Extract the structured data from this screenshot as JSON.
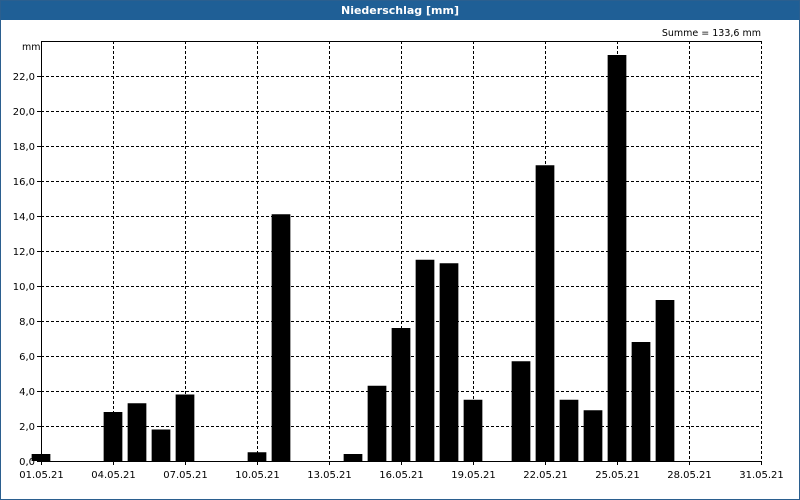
{
  "window": {
    "title": "Niederschlag [mm]"
  },
  "chart_data": {
    "type": "bar",
    "title": "Niederschlag [mm]",
    "ylabel": "mm",
    "annotation": "Summe = 133,6 mm",
    "ylim": [
      0,
      24
    ],
    "yticks": [
      0,
      2,
      4,
      6,
      8,
      10,
      12,
      14,
      16,
      18,
      20,
      22
    ],
    "ytick_labels": [
      "0,0",
      "2,0",
      "4,0",
      "6,0",
      "8,0",
      "10,0",
      "12,0",
      "14,0",
      "16,0",
      "18,0",
      "20,0",
      "22,0"
    ],
    "xlim_days": [
      1,
      31
    ],
    "xtick_days": [
      1,
      4,
      7,
      10,
      13,
      16,
      19,
      22,
      25,
      28,
      31
    ],
    "xtick_labels": [
      "01.05.21",
      "04.05.21",
      "07.05.21",
      "10.05.21",
      "13.05.21",
      "16.05.21",
      "19.05.21",
      "22.05.21",
      "25.05.21",
      "28.05.21",
      "31.05.21"
    ],
    "grid": true,
    "categories": [
      "01.05.21",
      "02.05.21",
      "03.05.21",
      "04.05.21",
      "05.05.21",
      "06.05.21",
      "07.05.21",
      "08.05.21",
      "09.05.21",
      "10.05.21",
      "11.05.21",
      "12.05.21",
      "13.05.21",
      "14.05.21",
      "15.05.21",
      "16.05.21",
      "17.05.21",
      "18.05.21",
      "19.05.21",
      "20.05.21",
      "21.05.21",
      "22.05.21",
      "23.05.21",
      "24.05.21",
      "25.05.21",
      "26.05.21",
      "27.05.21",
      "28.05.21",
      "29.05.21",
      "30.05.21",
      "31.05.21"
    ],
    "values": [
      0.4,
      0,
      0,
      2.8,
      3.3,
      1.8,
      3.8,
      0,
      0,
      0.5,
      14.1,
      0,
      0,
      0.4,
      4.3,
      7.6,
      11.5,
      11.3,
      3.5,
      0,
      5.7,
      16.9,
      3.5,
      2.9,
      23.2,
      6.8,
      9.2,
      0,
      0,
      0,
      0
    ],
    "bar_color": "#000000",
    "grid_color": "#000000",
    "title_bar_color": "#1f5f96"
  }
}
